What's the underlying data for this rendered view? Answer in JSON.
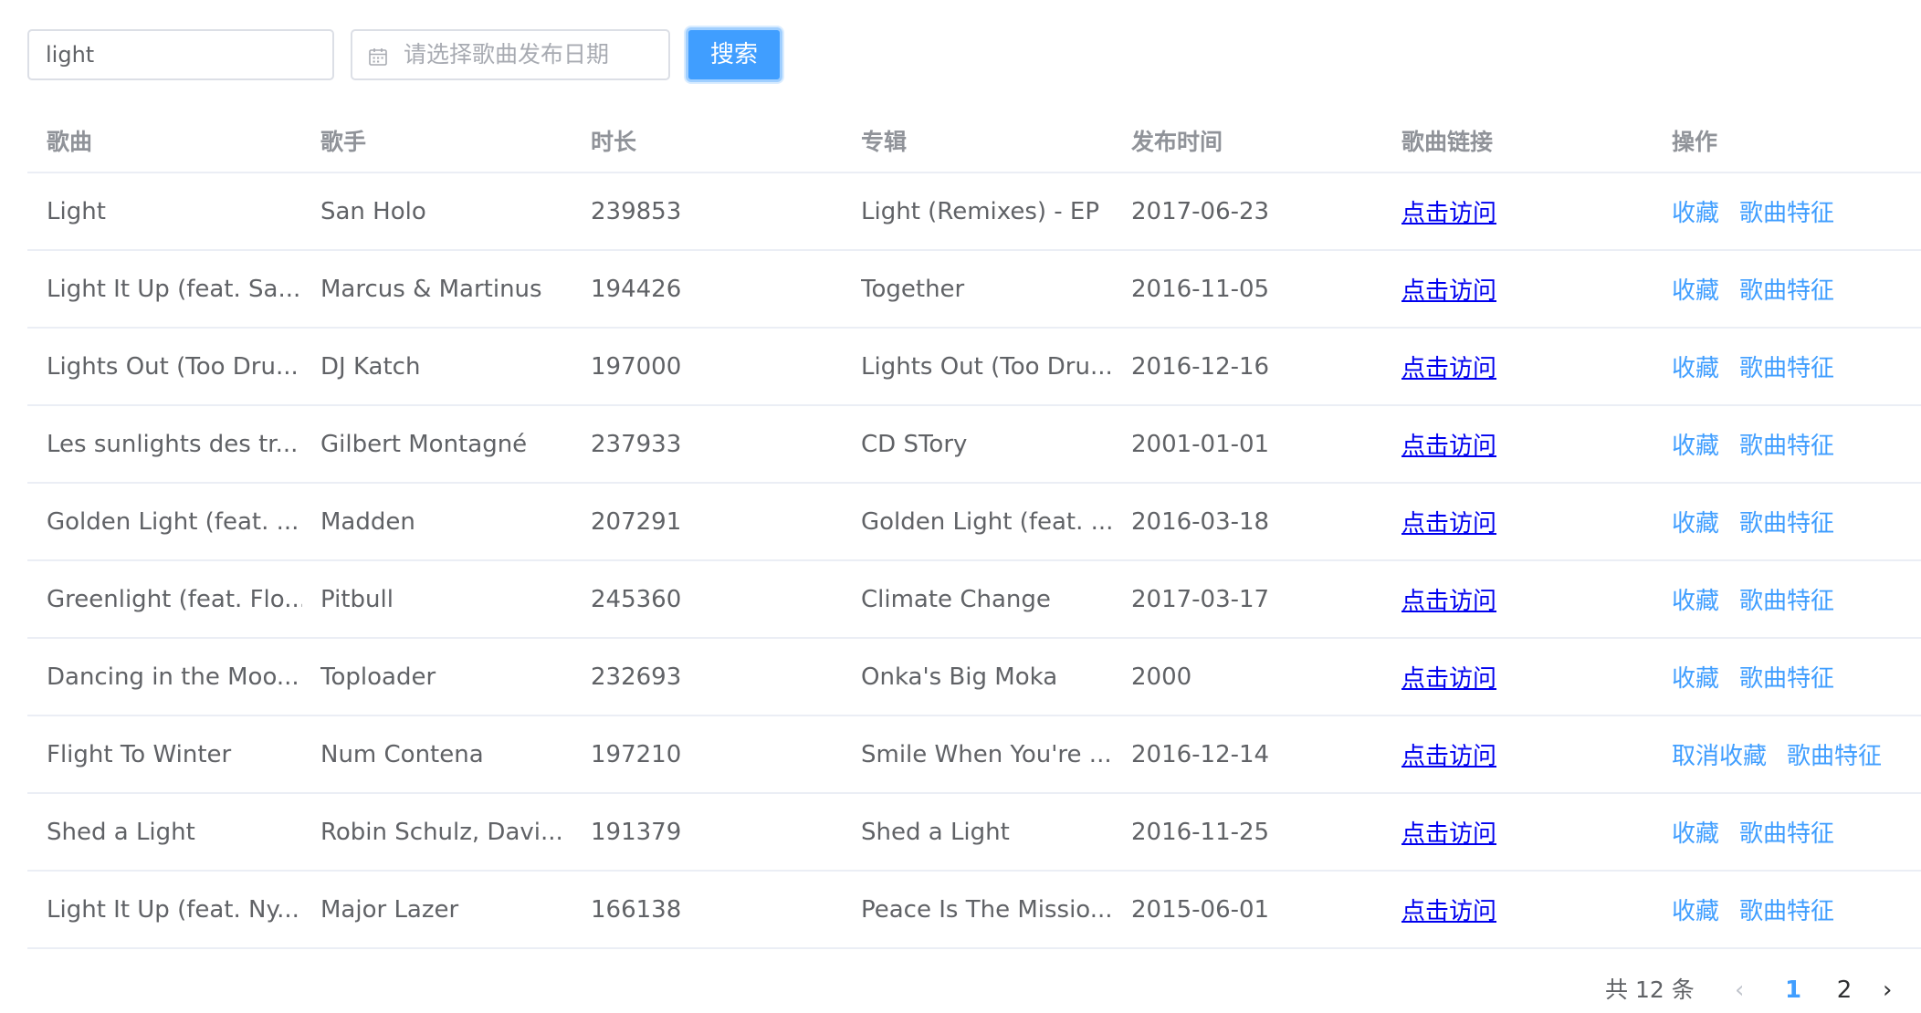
{
  "search": {
    "value": "light",
    "date_placeholder": "请选择歌曲发布日期",
    "button_label": "搜索"
  },
  "table": {
    "headers": [
      "歌曲",
      "歌手",
      "时长",
      "专辑",
      "发布时间",
      "歌曲链接",
      "操作"
    ],
    "rows": [
      {
        "song": "Light",
        "artist": "San Holo",
        "duration": "239853",
        "album": "Light (Remixes) - EP",
        "date": "2017-06-23",
        "link": "点击访问",
        "op1": "收藏",
        "op2": "歌曲特征"
      },
      {
        "song": "Light It Up (feat. Sa...",
        "artist": "Marcus & Martinus",
        "duration": "194426",
        "album": "Together",
        "date": "2016-11-05",
        "link": "点击访问",
        "op1": "收藏",
        "op2": "歌曲特征"
      },
      {
        "song": "Lights Out (Too Dru...",
        "artist": "DJ Katch",
        "duration": "197000",
        "album": "Lights Out (Too Dru...",
        "date": "2016-12-16",
        "link": "点击访问",
        "op1": "收藏",
        "op2": "歌曲特征"
      },
      {
        "song": "Les sunlights des tr...",
        "artist": "Gilbert Montagné",
        "duration": "237933",
        "album": "CD STory",
        "date": "2001-01-01",
        "link": "点击访问",
        "op1": "收藏",
        "op2": "歌曲特征"
      },
      {
        "song": "Golden Light (feat. ...",
        "artist": "Madden",
        "duration": "207291",
        "album": "Golden Light (feat. ...",
        "date": "2016-03-18",
        "link": "点击访问",
        "op1": "收藏",
        "op2": "歌曲特征"
      },
      {
        "song": "Greenlight (feat. Flo...",
        "artist": "Pitbull",
        "duration": "245360",
        "album": "Climate Change",
        "date": "2017-03-17",
        "link": "点击访问",
        "op1": "收藏",
        "op2": "歌曲特征"
      },
      {
        "song": "Dancing in the Moo...",
        "artist": "Toploader",
        "duration": "232693",
        "album": "Onka's Big Moka",
        "date": "2000",
        "link": "点击访问",
        "op1": "收藏",
        "op2": "歌曲特征"
      },
      {
        "song": "Flight To Winter",
        "artist": "Num Contena",
        "duration": "197210",
        "album": "Smile When You're ...",
        "date": "2016-12-14",
        "link": "点击访问",
        "op1": "取消收藏",
        "op2": "歌曲特征"
      },
      {
        "song": "Shed a Light",
        "artist": "Robin Schulz, Davi...",
        "duration": "191379",
        "album": "Shed a Light",
        "date": "2016-11-25",
        "link": "点击访问",
        "op1": "收藏",
        "op2": "歌曲特征"
      },
      {
        "song": "Light It Up (feat. Ny...",
        "artist": "Major Lazer",
        "duration": "166138",
        "album": "Peace Is The Missio...",
        "date": "2015-06-01",
        "link": "点击访问",
        "op1": "收藏",
        "op2": "歌曲特征"
      }
    ]
  },
  "pagination": {
    "total_text": "共 12 条",
    "pages": [
      "1",
      "2"
    ],
    "current_page": "1",
    "prev_icon": "chevron-left-icon",
    "next_icon": "chevron-right-icon"
  },
  "colors": {
    "primary": "#409eff",
    "link": "#0000ee",
    "text": "#606266",
    "header_text": "#909399"
  }
}
